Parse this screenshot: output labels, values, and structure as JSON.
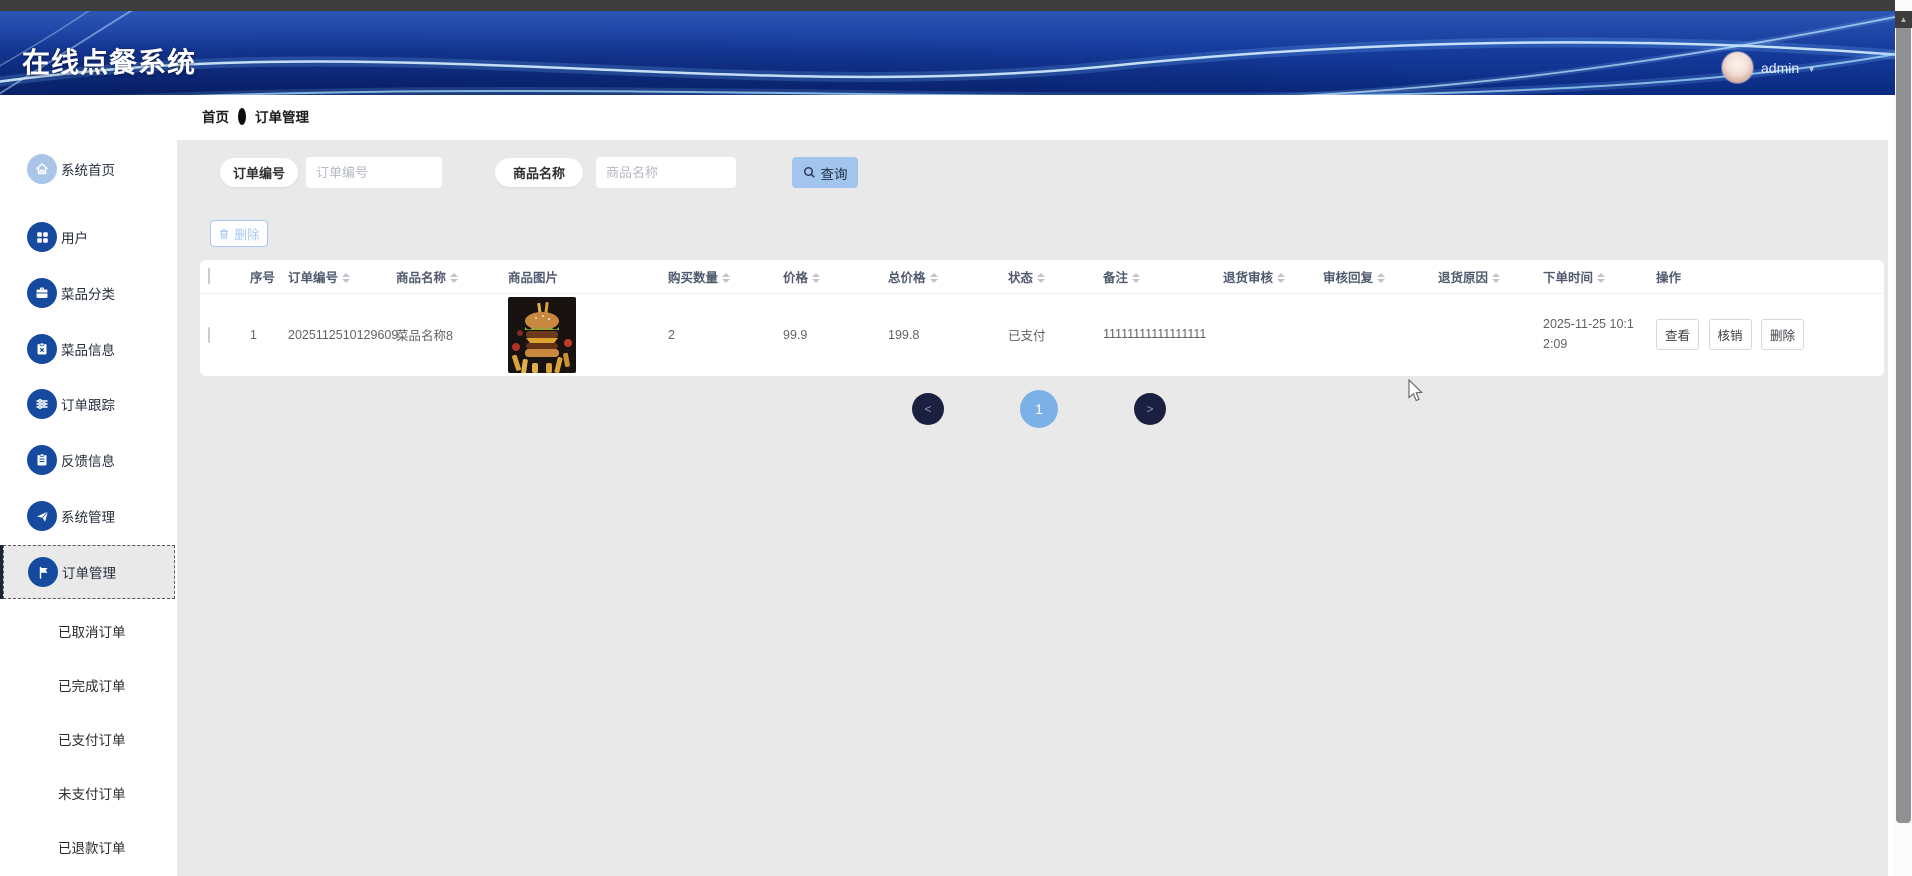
{
  "header": {
    "title": "在线点餐系统",
    "user_name": "admin"
  },
  "breadcrumb": {
    "home": "首页",
    "current": "订单管理"
  },
  "sidebar": {
    "items": [
      {
        "label": "系统首页",
        "icon": "home-icon"
      },
      {
        "label": "用户",
        "icon": "users-icon"
      },
      {
        "label": "菜品分类",
        "icon": "category-icon"
      },
      {
        "label": "菜品信息",
        "icon": "dish-info-icon"
      },
      {
        "label": "订单跟踪",
        "icon": "order-track-icon"
      },
      {
        "label": "反馈信息",
        "icon": "feedback-icon"
      },
      {
        "label": "系统管理",
        "icon": "system-manage-icon"
      },
      {
        "label": "订单管理",
        "icon": "flag-icon",
        "active": true
      }
    ],
    "sub_items": [
      {
        "label": "已取消订单"
      },
      {
        "label": "已完成订单"
      },
      {
        "label": "已支付订单"
      },
      {
        "label": "未支付订单"
      },
      {
        "label": "已退款订单"
      }
    ]
  },
  "search": {
    "order_no_label": "订单编号",
    "order_no_placeholder": "订单编号",
    "order_no_value": "",
    "product_label": "商品名称",
    "product_placeholder": "商品名称",
    "product_value": "",
    "query_button": "查询"
  },
  "toolbar": {
    "delete_button": "删除"
  },
  "table": {
    "columns": [
      {
        "label": "序号",
        "sortable": false
      },
      {
        "label": "订单编号",
        "sortable": true
      },
      {
        "label": "商品名称",
        "sortable": true
      },
      {
        "label": "商品图片",
        "sortable": false
      },
      {
        "label": "购买数量",
        "sortable": true
      },
      {
        "label": "价格",
        "sortable": true
      },
      {
        "label": "总价格",
        "sortable": true
      },
      {
        "label": "状态",
        "sortable": true
      },
      {
        "label": "备注",
        "sortable": true
      },
      {
        "label": "退货审核",
        "sortable": true
      },
      {
        "label": "审核回复",
        "sortable": true
      },
      {
        "label": "退货原因",
        "sortable": true
      },
      {
        "label": "下单时间",
        "sortable": true
      },
      {
        "label": "操作",
        "sortable": false
      }
    ],
    "rows": [
      {
        "index": "1",
        "order_no": "2025112510129609",
        "product_name": "菜品名称8",
        "product_image": "burger-photo",
        "quantity": "2",
        "price": "99.9",
        "total_price": "199.8",
        "status": "已支付",
        "remark": "11111111111111111",
        "return_review": "",
        "review_reply": "",
        "return_reason": "",
        "order_time": "2025-11-25 10:12:09"
      }
    ],
    "row_actions": [
      {
        "label": "查看"
      },
      {
        "label": "核销"
      },
      {
        "label": "删除"
      }
    ]
  },
  "pagination": {
    "prev": "<",
    "current_page": "1",
    "next": ">"
  },
  "colors": {
    "banner_blue": "#163c9e",
    "sidebar_icon_blue": "#164a9e",
    "query_button_blue": "#a2c5ee",
    "pagination_navy": "#1b2040",
    "pagination_active_blue": "#7cb1e8",
    "panel_gray": "#e9e9e9",
    "top_strip_gray": "#3d3d3d"
  }
}
